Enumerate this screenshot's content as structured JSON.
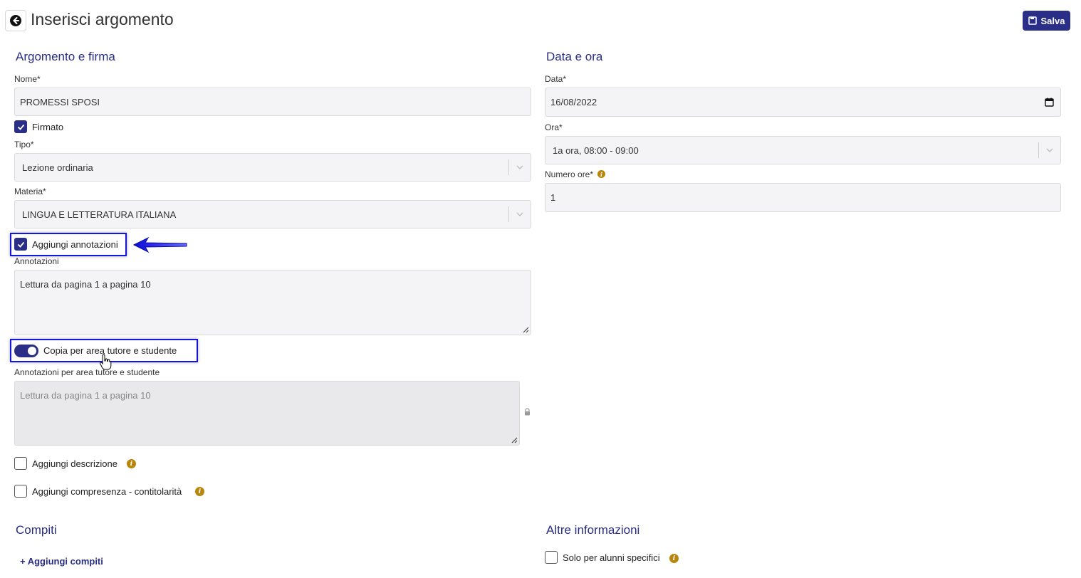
{
  "header": {
    "title": "Inserisci argomento",
    "save_label": "Salva"
  },
  "left": {
    "section_title": "Argomento e firma",
    "nome": {
      "label": "Nome*",
      "value": "PROMESSI SPOSI"
    },
    "firmato": {
      "label": "Firmato",
      "checked": true
    },
    "tipo": {
      "label": "Tipo*",
      "value": "Lezione ordinaria"
    },
    "materia": {
      "label": "Materia*",
      "value": "LINGUA E LETTERATURA ITALIANA"
    },
    "aggiungi_annotazioni": {
      "label": "Aggiungi annotazioni",
      "checked": true
    },
    "annotazioni": {
      "label": "Annotazioni",
      "value": "Lettura da pagina 1 a pagina 10"
    },
    "copia_toggle": {
      "label": "Copia per area tutore e studente",
      "on": true
    },
    "annotazioni_tutore": {
      "label": "Annotazioni per area tutore e studente",
      "value": "Lettura da pagina 1 a pagina 10"
    },
    "aggiungi_descrizione": {
      "label": "Aggiungi descrizione",
      "checked": false
    },
    "aggiungi_compresenza": {
      "label": "Aggiungi compresenza - contitolarità",
      "checked": false
    }
  },
  "right": {
    "section_title": "Data e ora",
    "data": {
      "label": "Data*",
      "value": "16/08/2022"
    },
    "ora": {
      "label": "Ora*",
      "value": "1a ora, 08:00 - 09:00"
    },
    "numero_ore": {
      "label": "Numero ore*",
      "value": "1"
    }
  },
  "compiti": {
    "section_title": "Compiti",
    "add_link": "+ Aggiungi compiti"
  },
  "altre": {
    "section_title": "Altre informazioni",
    "solo_alunni": {
      "label": "Solo per alunni specifici",
      "checked": false
    }
  },
  "colors": {
    "accent": "#2a2e86",
    "highlight": "#1515dd",
    "info": "#b8860b"
  }
}
